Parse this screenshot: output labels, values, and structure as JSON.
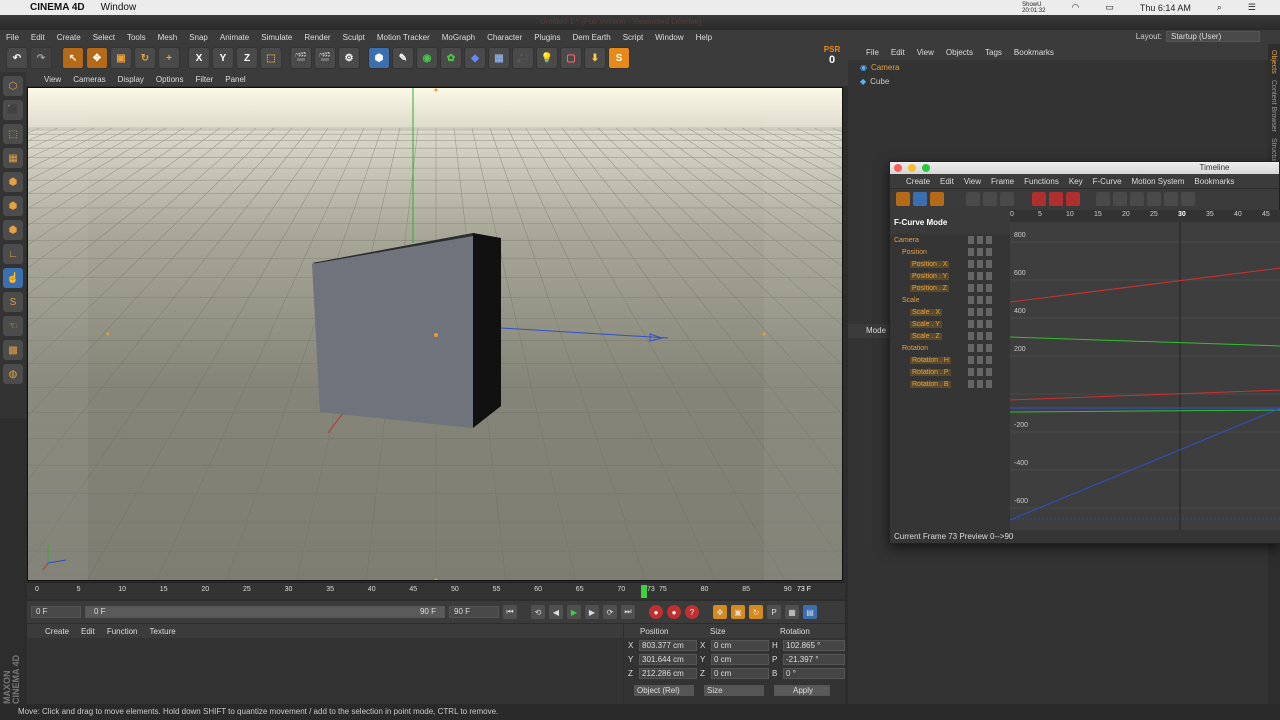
{
  "mac": {
    "app_name": "CINEMA 4D",
    "menu": "Window",
    "clock": "Thu 6:14 AM",
    "recording": "ShowU\n20:01:32"
  },
  "window_title": "Untitled 1 * (Full Version - Restricted License)",
  "main_menu": [
    "File",
    "Edit",
    "Create",
    "Select",
    "Tools",
    "Mesh",
    "Snap",
    "Animate",
    "Simulate",
    "Render",
    "Sculpt",
    "Motion Tracker",
    "MoGraph",
    "Character",
    "Plugins",
    "Dem Earth",
    "Script",
    "Window",
    "Help"
  ],
  "layout": {
    "label": "Layout:",
    "value": "Startup (User)"
  },
  "toolbar": {
    "psr_label": "PSR",
    "psr_value": "0",
    "axis_x": "X",
    "axis_y": "Y",
    "axis_z": "Z"
  },
  "viewport_menu": [
    "View",
    "Cameras",
    "Display",
    "Options",
    "Filter",
    "Panel"
  ],
  "timeline_ruler": {
    "ticks": [
      "0",
      "5",
      "10",
      "15",
      "20",
      "25",
      "30",
      "35",
      "40",
      "45",
      "50",
      "55",
      "60",
      "65",
      "70",
      "75",
      "80",
      "85",
      "90"
    ],
    "current_marker": "73",
    "end_label": "73 F"
  },
  "playback": {
    "start_frame": "0 F",
    "slider_left": "0 F",
    "slider_right": "90 F",
    "end_frame": "90 F"
  },
  "material_menu": [
    "Create",
    "Edit",
    "Function",
    "Texture"
  ],
  "coords": {
    "headers": [
      "Position",
      "Size",
      "Rotation"
    ],
    "rows": [
      {
        "axis": "X",
        "pos": "803.377 cm",
        "size_axis": "X",
        "size": "0 cm",
        "rot_axis": "H",
        "rot": "102.865 °"
      },
      {
        "axis": "Y",
        "pos": "301.644 cm",
        "size_axis": "Y",
        "size": "0 cm",
        "rot_axis": "P",
        "rot": "-21.397 °"
      },
      {
        "axis": "Z",
        "pos": "212.286 cm",
        "size_axis": "Z",
        "size": "0 cm",
        "rot_axis": "B",
        "rot": "0 °"
      }
    ],
    "mode_select": "Object (Rel)",
    "size_select": "Size",
    "apply": "Apply"
  },
  "status": "Move: Click and drag to move elements. Hold down SHIFT to quantize movement / add to the selection in point mode, CTRL to remove.",
  "object_manager": {
    "menu": [
      "File",
      "Edit",
      "View",
      "Objects",
      "Tags",
      "Bookmarks"
    ],
    "objects": [
      "Camera",
      "Cube"
    ]
  },
  "side_tabs": [
    "Objects",
    "Content Browser",
    "Structure"
  ],
  "attr_mode": "Mode",
  "timeline_window": {
    "title": "Timeline",
    "menu": [
      "Create",
      "Edit",
      "View",
      "Frame",
      "Functions",
      "Key",
      "F-Curve",
      "Motion System",
      "Bookmarks"
    ],
    "mode": "F-Curve Mode",
    "ruler": [
      "0",
      "5",
      "10",
      "15",
      "20",
      "25",
      "30",
      "35",
      "40",
      "45"
    ],
    "tracks": [
      "Camera",
      "Position",
      "Position . X",
      "Position . Y",
      "Position . Z",
      "Scale",
      "Scale . X",
      "Scale . Y",
      "Scale . Z",
      "Rotation",
      "Rotation . H",
      "Rotation . P",
      "Rotation . B"
    ],
    "y_labels": [
      "800",
      "600",
      "400",
      "200",
      "-200",
      "-400",
      "-600"
    ],
    "footer": "Current Frame  73  Preview  0-->90"
  },
  "branding": "MAXON\nCINEMA 4D",
  "colors": {
    "accent": "#e88a1a",
    "x_axis": "#d03030",
    "y_axis": "#30c030",
    "z_axis": "#3050d0"
  }
}
